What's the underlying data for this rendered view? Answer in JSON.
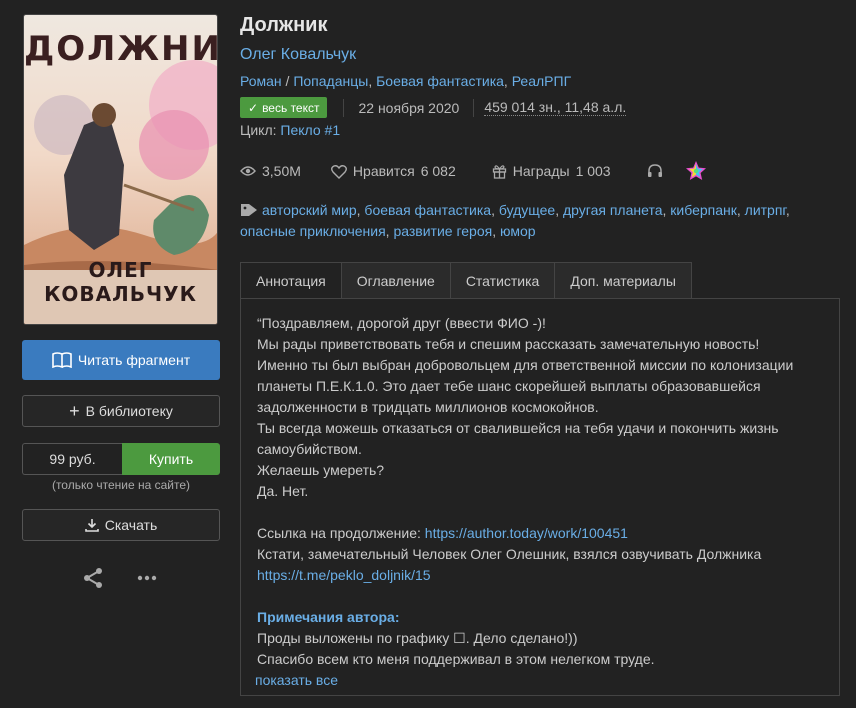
{
  "cover": {
    "title": "ДОЛЖНИК",
    "author": "ОЛЕГ КОВАЛЬЧУК"
  },
  "actions": {
    "read_label": "Читать фрагмент",
    "library_label": "В библиотеку",
    "price": "99 руб.",
    "buy_label": "Купить",
    "buy_note": "(только чтение на сайте)",
    "download_label": "Скачать"
  },
  "book": {
    "title": "Должник",
    "author": "Олег Ковальчук",
    "genres": [
      "Роман",
      "Попаданцы",
      "Боевая фантастика",
      "РеалРПГ"
    ],
    "status_badge": "весь текст",
    "date": "22 ноября 2020",
    "size": "459 014 зн., 11,48 а.л.",
    "cycle_label": "Цикл:",
    "cycle_name": "Пекло #1"
  },
  "stats": {
    "views": "3,50M",
    "likes_label": "Нравится",
    "likes": "6 082",
    "awards_label": "Награды",
    "awards": "1 003"
  },
  "tags": [
    "авторский мир",
    "боевая фантастика",
    "будущее",
    "другая планета",
    "киберпанк",
    "литрпг",
    "опасные приключения",
    "развитие героя",
    "юмор"
  ],
  "tabs": [
    "Аннотация",
    "Оглавление",
    "Статистика",
    "Доп. материалы"
  ],
  "annotation": {
    "lines": [
      "“Поздравляем, дорогой друг (ввести ФИО -)!",
      "Мы рады приветствовать тебя и спешим рассказать замечательную новость!",
      "Именно ты был выбран добровольцем для ответственной миссии по колонизации планеты П.Е.К.1.0. Это дает тебе шанс скорейшей выплаты образовавшейся задолженности в тридцать миллионов космокойнов.",
      "Ты всегда можешь отказаться от свалившейся на тебя удачи и покончить жизнь самоубийством.",
      "Желаешь умереть?",
      "Да. Нет."
    ],
    "continuation_label": "Ссылка на продолжение: ",
    "continuation_url": "https://author.today/work/100451",
    "narrator_text": "Кстати, замечательный Человек Олег Олешник, взялся озвучивать Должника",
    "narrator_url": "https://t.me/peklo_doljnik/15",
    "notes_heading": "Примечания автора:",
    "notes_lines": [
      "Проды выложены по графику ☐. Дело сделано!))",
      "Спасибо всем кто меня поддерживал в этом нелегком труде."
    ],
    "show_all": "показать все"
  },
  "colors": {
    "accent": "#6aaee6",
    "read_button": "#3a7bbf",
    "buy_button": "#4c9a3f",
    "background": "#222222"
  }
}
